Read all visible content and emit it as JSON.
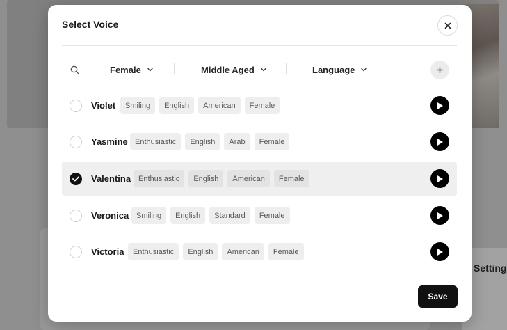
{
  "background": {
    "settings_label": "Settings"
  },
  "modal": {
    "title": "Select Voice",
    "close_icon": "close-icon",
    "save_label": "Save"
  },
  "filters": {
    "search_icon": "search-icon",
    "gender": "Female",
    "age": "Middle Aged",
    "language": "Language",
    "add_icon": "plus-icon"
  },
  "voices": [
    {
      "name": "Violet",
      "selected": false,
      "tags": [
        "Smiling",
        "English",
        "American",
        "Female"
      ]
    },
    {
      "name": "Yasmine",
      "selected": false,
      "tags": [
        "Enthusiastic",
        "English",
        "Arab",
        "Female"
      ]
    },
    {
      "name": "Valentina",
      "selected": true,
      "tags": [
        "Enthusiastic",
        "English",
        "American",
        "Female"
      ]
    },
    {
      "name": "Veronica",
      "selected": false,
      "tags": [
        "Smiling",
        "English",
        "Standard",
        "Female"
      ]
    },
    {
      "name": "Victoria",
      "selected": false,
      "tags": [
        "Enthusiastic",
        "English",
        "American",
        "Female"
      ]
    }
  ],
  "colors": {
    "selected_row": "#efefef",
    "primary": "#111111"
  }
}
